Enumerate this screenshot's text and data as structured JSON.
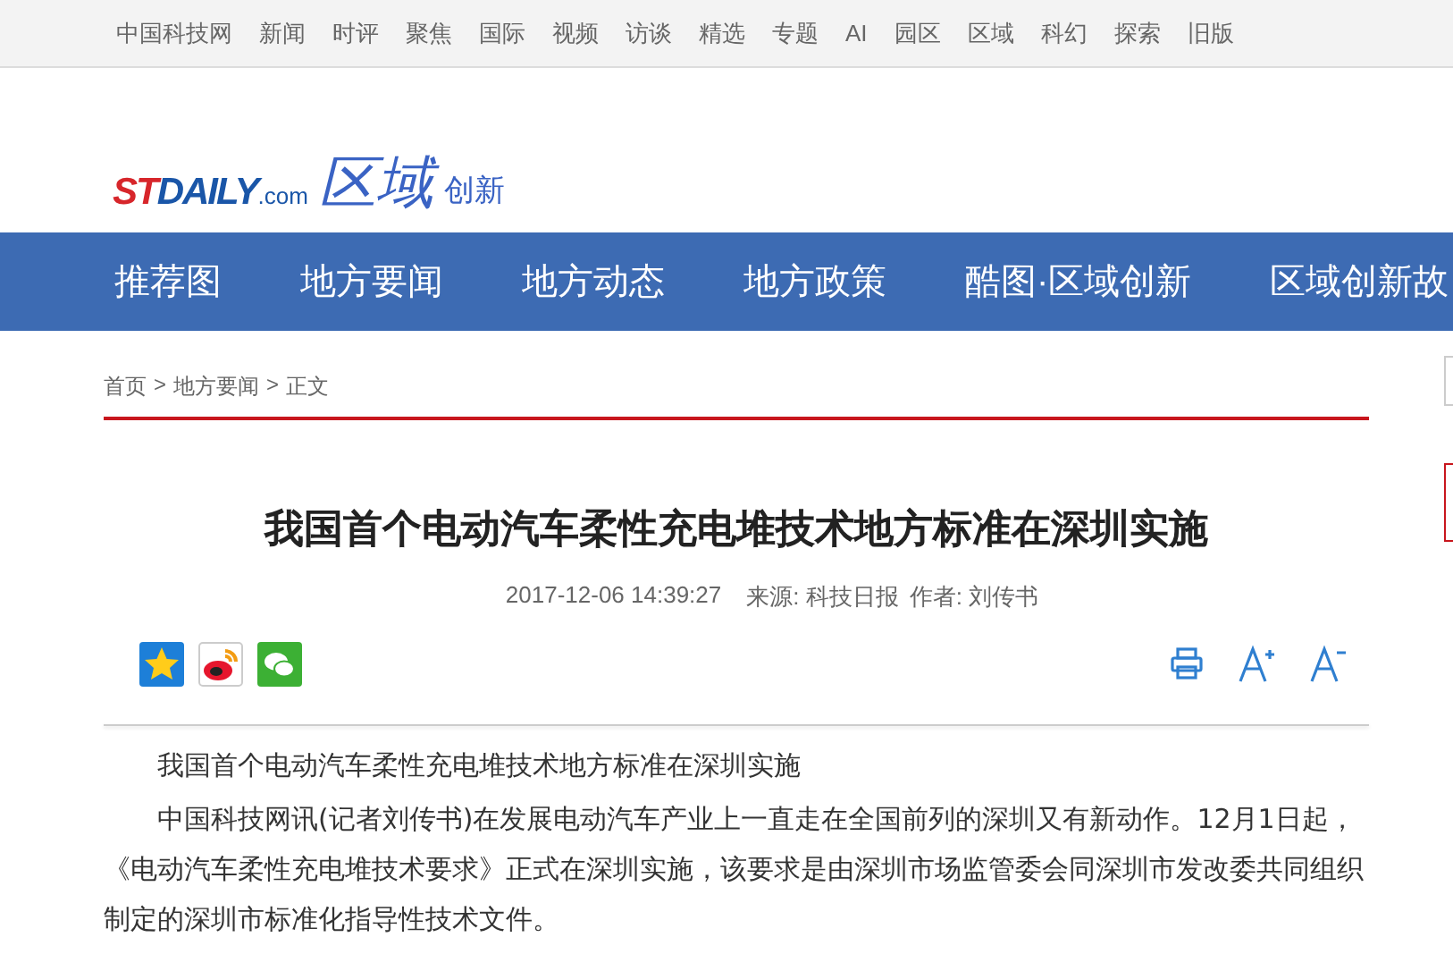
{
  "top_links": [
    "中国科技网",
    "新闻",
    "时评",
    "聚焦",
    "国际",
    "视频",
    "访谈",
    "精选",
    "专题",
    "AI",
    "园区",
    "区域",
    "科幻",
    "探索",
    "旧版"
  ],
  "logo": {
    "brand_red": "ST",
    "brand_blue": "DAILY",
    "suffix": ".com",
    "region": "区域",
    "tagline": "创新"
  },
  "nav": [
    "推荐图",
    "地方要闻",
    "地方动态",
    "地方政策",
    "酷图·区域创新",
    "区域创新故"
  ],
  "breadcrumb": [
    "首页",
    "地方要闻",
    "正文"
  ],
  "breadcrumb_separator": ">",
  "article": {
    "title": "我国首个电动汽车柔性充电堆技术地方标准在深圳实施",
    "date": "2017-12-06 14:39:27",
    "source": "来源: 科技日报",
    "author": "作者: 刘传书",
    "paragraphs": [
      "我国首个电动汽车柔性充电堆技术地方标准在深圳实施",
      "中国科技网讯(记者刘传书)在发展电动汽车产业上一直走在全国前列的深圳又有新动作。12月1日起，《电动汽车柔性充电堆技术要求》正式在深圳实施，该要求是由深圳市场监管委会同深圳市发改委共同组织制定的深圳市标准化指导性技术文件。"
    ]
  }
}
